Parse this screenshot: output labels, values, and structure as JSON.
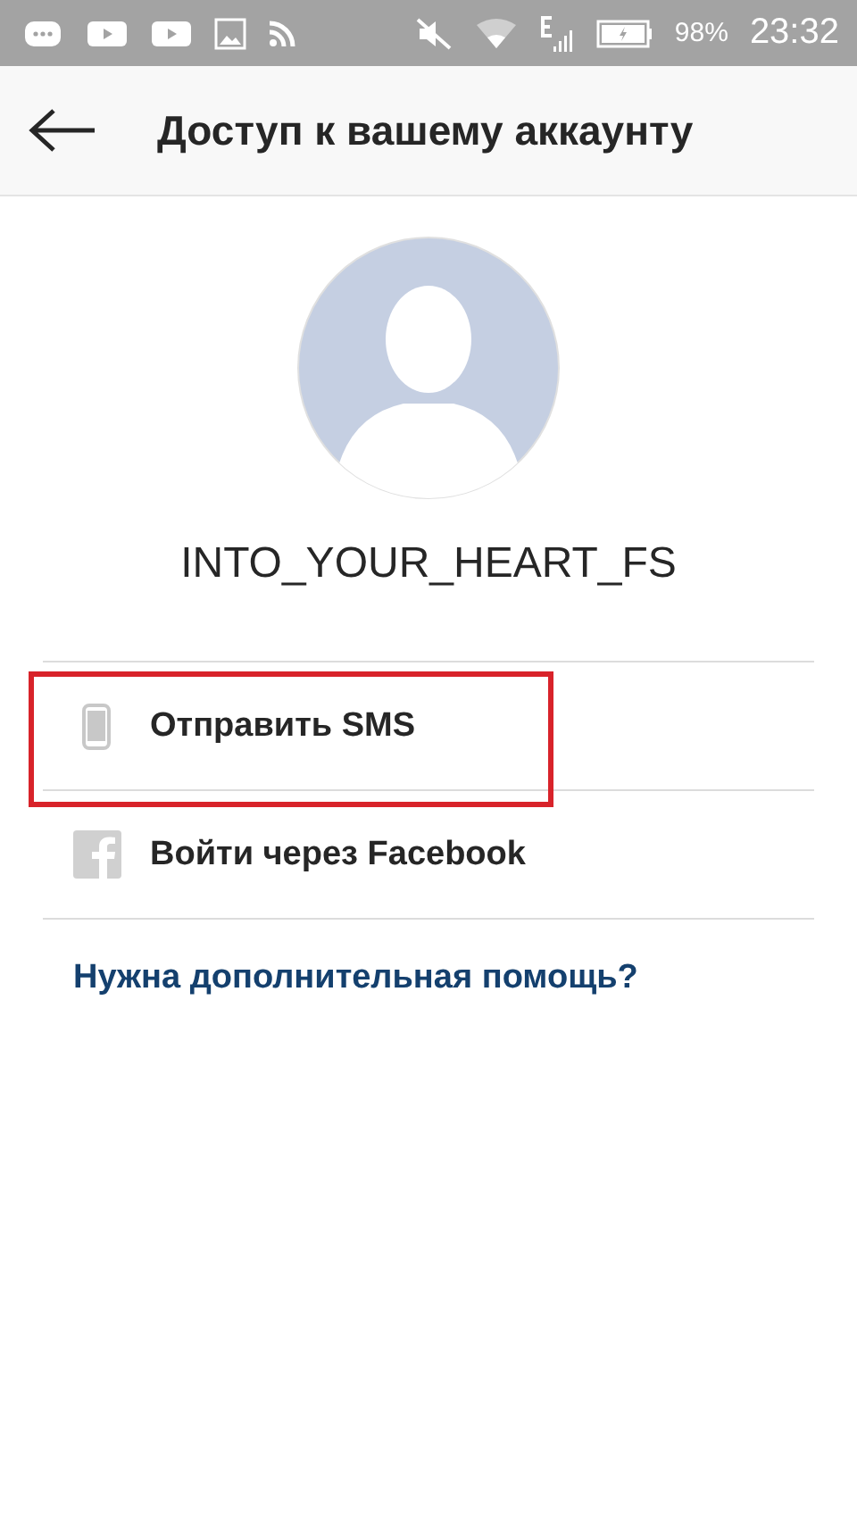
{
  "status_bar": {
    "battery": "98%",
    "time": "23:32"
  },
  "header": {
    "title": "Доступ к вашему аккаунту"
  },
  "account": {
    "username": "INTO_YOUR_HEART_FS"
  },
  "options": [
    {
      "kind": "sms",
      "label": "Отправить SMS",
      "highlighted": true
    },
    {
      "kind": "facebook",
      "label": "Войти через Facebook",
      "highlighted": false
    }
  ],
  "help_link": "Нужна дополнительная помощь?"
}
